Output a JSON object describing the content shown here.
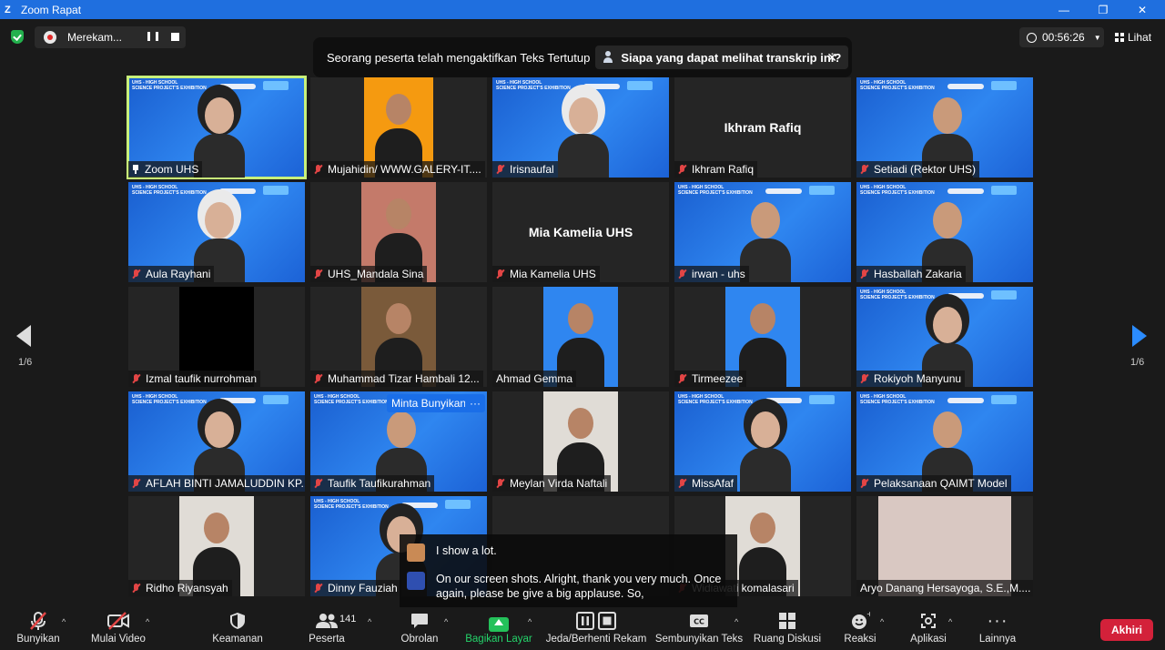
{
  "window": {
    "title": "Zoom Rapat",
    "logo": "Z",
    "minimize": "—",
    "restore": "❐",
    "close": "✕"
  },
  "recording": {
    "label": "Merekam..."
  },
  "cc_banner": {
    "text": "Seorang peserta telah mengaktifkan Teks Tertutup",
    "link": "Siapa yang dapat melihat transkrip ini?",
    "close": "✕"
  },
  "timer": "00:56:26",
  "view": "Lihat",
  "paging": {
    "left": "1/6",
    "right": "1/6"
  },
  "tiles": [
    {
      "name": "Zoom UHS",
      "bg": "blue",
      "person": "hij",
      "speaking": true,
      "pinned": true
    },
    {
      "name": "Mujahidin/ WWW.GALERY-IT....",
      "photo": "orange"
    },
    {
      "name": "Irisnaufal",
      "bg": "blue",
      "person": "hij-w"
    },
    {
      "name": "Ikhram Rafiq",
      "center": "Ikhram Rafiq"
    },
    {
      "name": "Setiadi (Rektor UHS)",
      "bg": "blue",
      "person": "man"
    },
    {
      "name": "Aula Rayhani",
      "bg": "blue",
      "person": "hij-w"
    },
    {
      "name": "UHS_Mandala Sina",
      "photo": "pink"
    },
    {
      "name": "Mia Kamelia UHS",
      "center": "Mia Kamelia UHS"
    },
    {
      "name": "irwan - uhs",
      "bg": "blue",
      "person": "man"
    },
    {
      "name": "Hasballah Zakaria",
      "bg": "blue",
      "person": "man"
    },
    {
      "name": "Izmal taufik nurrohman",
      "photo": "black"
    },
    {
      "name": "Muhammad Tizar Hambali 12...",
      "photo": "tan"
    },
    {
      "name": "Ahmad Gemma",
      "photo": "blue",
      "nomic": true
    },
    {
      "name": "Tirmeezee",
      "photo": "blue"
    },
    {
      "name": "Rokiyoh Manyunu",
      "bg": "blue",
      "person": "hij"
    },
    {
      "name": "AFLAH BINTI JAMALUDDIN KP...",
      "bg": "blue",
      "person": "hij"
    },
    {
      "name": "Taufik Taufikurahman",
      "bg": "blue",
      "person": "man",
      "minta": "Minta Bunyikan",
      "dots": "···"
    },
    {
      "name": "Meylan Virda Naftali",
      "photo": "light"
    },
    {
      "name": "MissAfaf",
      "bg": "blue",
      "person": "hij"
    },
    {
      "name": "Pelaksanaan QAIMT Model",
      "bg": "blue",
      "person": "man"
    },
    {
      "name": "Ridho Riyansyah",
      "photo": "light"
    },
    {
      "name": "Dinny Fauziah",
      "bg": "blue",
      "person": "hij"
    },
    {
      "name": "",
      "empty": true
    },
    {
      "name": "Widiawati komalasari",
      "photo": "light"
    },
    {
      "name": "Aryo Danang Hersayoga, S.E.,M....",
      "photo": "room",
      "nomic": true
    }
  ],
  "bg_header": "UHS - HIGH SCHOOL\nSCIENCE PROJECT'S EXHIBITION",
  "captions": [
    {
      "text": "I show a lot."
    },
    {
      "text": "On our screen shots. Alright, thank you very much. Once again, please be give a big applause. So,"
    }
  ],
  "toolbar": {
    "unmute": "Bunyikan",
    "start_video": "Mulai Video",
    "security": "Keamanan",
    "participants": "Peserta",
    "participants_count": "141",
    "chat": "Obrolan",
    "share": "Bagikan Layar",
    "pause_rec": "Jeda/Berhenti Rekam",
    "hide_captions": "Sembunyikan Teks",
    "breakout": "Ruang Diskusi",
    "reactions": "Reaksi",
    "apps": "Aplikasi",
    "more": "Lainnya",
    "end": "Akhiri",
    "caret": "^"
  },
  "colors": {
    "accent": "#1f6fdf",
    "share_green": "#24d36a",
    "end_red": "#d3213a",
    "speaking": "#c8f07a",
    "muted_red": "#e24545"
  }
}
